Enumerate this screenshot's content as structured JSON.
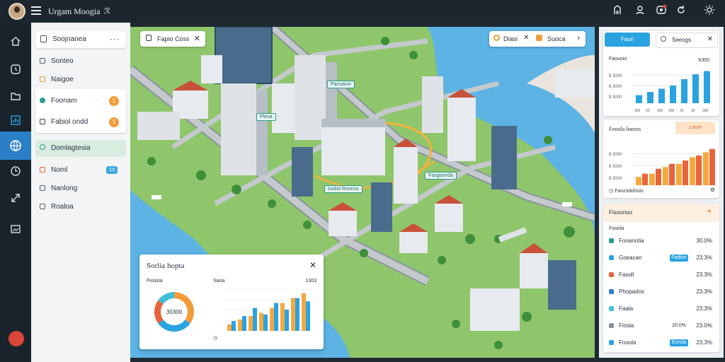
{
  "app": {
    "title": "Urgam Moogia",
    "title_badge": "ℛ"
  },
  "topbar_icons": [
    "building-icon",
    "user-icon",
    "notification-icon",
    "refresh-icon",
    "sun-icon"
  ],
  "rail_icons": [
    "home-icon",
    "clock-icon",
    "folder-icon",
    "chart-icon",
    "globe-icon",
    "history-icon",
    "share-icon",
    "image-icon"
  ],
  "sidebar": {
    "header": {
      "label": "Soojnanea",
      "more": "···"
    },
    "items": [
      {
        "label": "Sonteo"
      },
      {
        "label": "Naigoe"
      }
    ],
    "card_items": [
      {
        "label": "Foonam",
        "badge": "1"
      },
      {
        "label": "Fabiol ondd",
        "badge": "1"
      }
    ],
    "selected": {
      "label": "Domlagtesia"
    },
    "bottom_items": [
      {
        "label": "Noml",
        "badge": "1ó"
      },
      {
        "label": "Nanlong"
      },
      {
        "label": "Roaloa"
      }
    ]
  },
  "map": {
    "search_chip": {
      "label": "Fapio Coss"
    },
    "route_chip": {
      "from": "Diasi",
      "to": "Suoca"
    },
    "labels": [
      {
        "text": "Pansanvi"
      },
      {
        "text": "Plesa"
      },
      {
        "text": "Fasgoonda"
      },
      {
        "text": "Ioolisl Roonss"
      }
    ]
  },
  "float_card": {
    "title": "Sorlia hopta",
    "left_label": "Fiosioa",
    "mid_label": "Saoa",
    "right_label": "1303",
    "donut_center": "30300",
    "y_ticks": [
      "",
      "",
      "",
      ""
    ],
    "x_ticks": [
      "",
      "",
      "",
      "",
      "",
      "",
      ""
    ]
  },
  "right_panel": {
    "tabs": [
      {
        "label": "Faon"
      },
      {
        "label": "Seeogs"
      }
    ],
    "chart1": {
      "title": "Faouoio",
      "legend_value": "6300",
      "y_ticks": [
        "$ 3000",
        "$ 3000",
        "$ 3000"
      ],
      "x_ticks": [
        "300",
        "30",
        "300",
        "300",
        "30",
        "30",
        "300"
      ]
    },
    "chart2": {
      "title": "Fooola hansss",
      "badge": "Loool",
      "y_ticks": [
        "$ 3000",
        "$ 3000",
        "$ 3000"
      ],
      "footer": "Fanzsdohisis"
    },
    "table": {
      "title": "Fisoonoo",
      "subtitle": "Fooola",
      "rows": [
        {
          "name": "Fooanotia",
          "value": "",
          "pct": "30.0%"
        },
        {
          "name": "Goeacan",
          "value": "Fadlon",
          "pct": "23.3%"
        },
        {
          "name": "Fasoll",
          "value": "",
          "pct": "23.3%"
        },
        {
          "name": "Phopados",
          "value": "",
          "pct": "23.3%"
        },
        {
          "name": "Faala",
          "value": "",
          "pct": "23.3%"
        },
        {
          "name": "Fiosla",
          "value": "20.0%",
          "pct": "23.0%"
        },
        {
          "name": "Fooola",
          "value": "Eurola",
          "pct": "23.3%"
        }
      ]
    }
  },
  "colors": {
    "accent": "#2a7fc7",
    "water": "#5cb3e4",
    "teal": "#2a9c8c",
    "orange": "#f29b3a",
    "bar_blue": "#2aa3e0"
  },
  "chart_data": [
    {
      "type": "bar",
      "title": "Faouoio",
      "categories": [
        "300",
        "30",
        "300",
        "300",
        "30",
        "30",
        "300"
      ],
      "values": [
        10,
        14,
        18,
        22,
        30,
        36,
        40
      ]
    },
    {
      "type": "bar",
      "title": "Fooola hansss",
      "series": [
        {
          "values": [
            10,
            14,
            22,
            26,
            34,
            40
          ]
        },
        {
          "values": [
            14,
            20,
            26,
            30,
            36,
            44
          ]
        }
      ]
    },
    {
      "type": "pie",
      "slices": [
        {
          "value": 35,
          "color": "#f29b3a"
        },
        {
          "value": 30,
          "color": "#2aa3e0"
        },
        {
          "value": 20,
          "color": "#e8643a"
        },
        {
          "value": 15,
          "color": "#3fc0d8"
        }
      ]
    },
    {
      "type": "bar",
      "series": [
        {
          "values": [
            8,
            14,
            18,
            22,
            28,
            34,
            40,
            46
          ]
        },
        {
          "values": [
            12,
            18,
            28,
            20,
            34,
            26,
            40,
            36
          ]
        }
      ]
    }
  ]
}
